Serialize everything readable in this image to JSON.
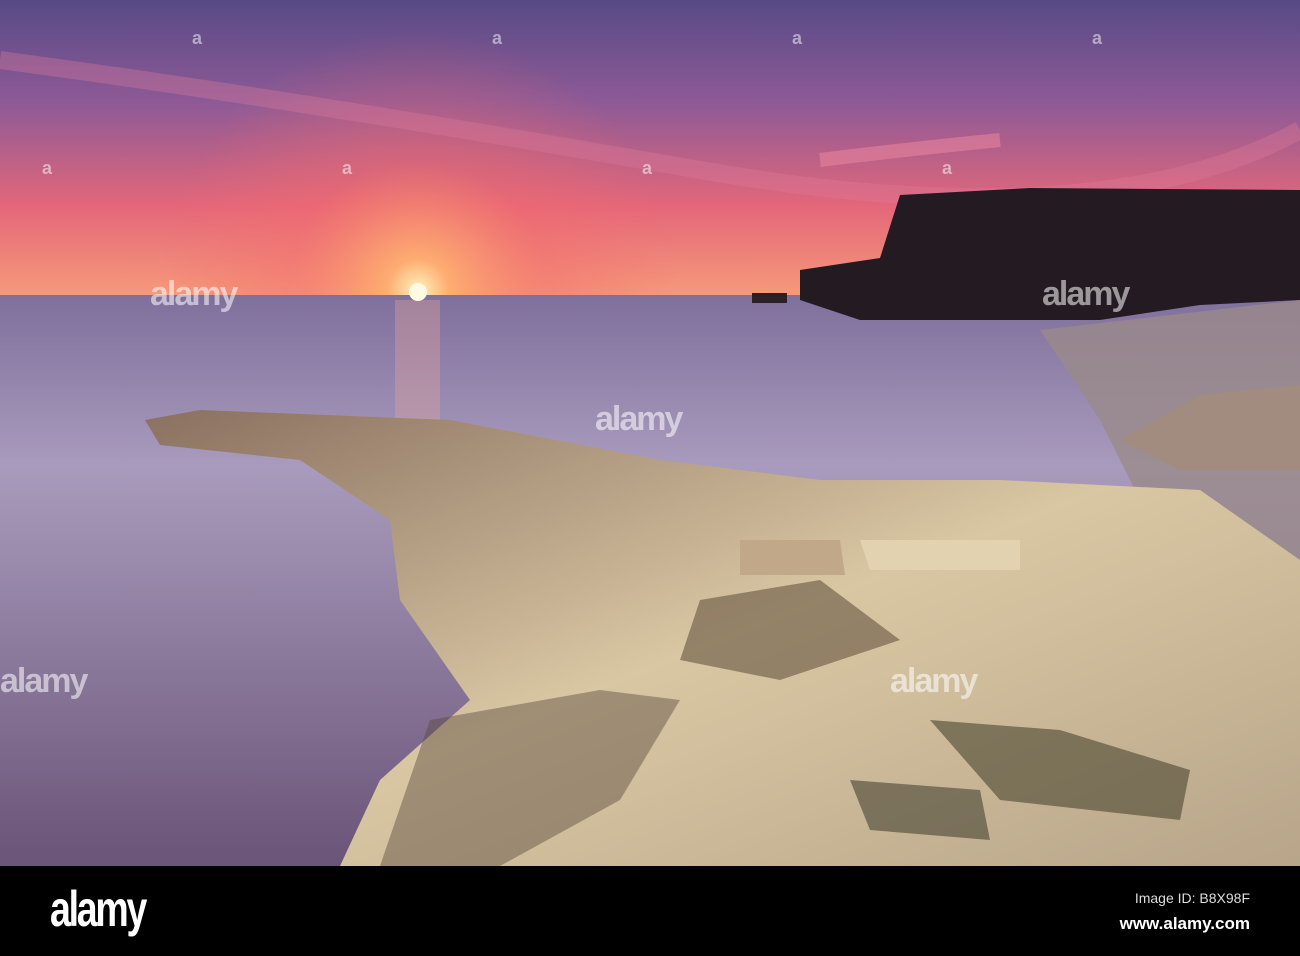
{
  "photo": {
    "description_colors": {
      "sky_top": "#5a4a8a",
      "sky_glow": "#f36a6a",
      "sun": "#fff2b0",
      "sea": "#8a7fa8",
      "rock": "#d8c6a0",
      "cliff": "#231a22"
    }
  },
  "watermark": {
    "text": "alamy",
    "mark": "a"
  },
  "footer": {
    "logo": "alamy",
    "image_id": "Image ID: B8X98F",
    "url": "www.alamy.com"
  }
}
